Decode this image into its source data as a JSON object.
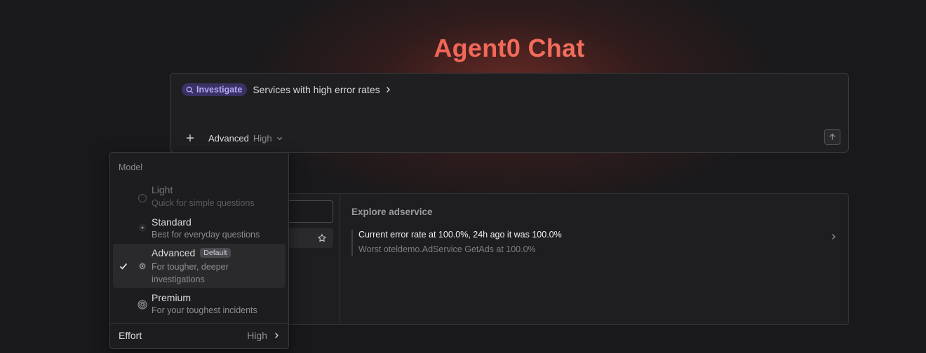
{
  "page": {
    "title": "Agent0 Chat",
    "accent_gradient": [
      "#ef4a44",
      "#f49a82"
    ]
  },
  "composer": {
    "suggestion_badge": "Investigate",
    "suggestion_badge_icon": "search-icon",
    "suggestion_text": "Services with high error rates",
    "add_icon": "plus-icon",
    "model_label": "Advanced",
    "effort_label": "High",
    "send_icon": "arrow-up-icon"
  },
  "panel": {
    "explore_title": "Explore adservice",
    "insight_main": "Current error rate at 100.0%, 24h ago it was 100.0%",
    "insight_sub": "Worst oteldemo.AdService GetAds at 100.0%"
  },
  "dropdown": {
    "header": "Model",
    "options": [
      {
        "label": "Light",
        "desc": "Quick for simple questions",
        "disabled": true,
        "selected": false
      },
      {
        "label": "Standard",
        "desc": "Best for everyday questions",
        "disabled": false,
        "selected": false
      },
      {
        "label": "Advanced",
        "badge": "Default",
        "desc": "For tougher, deeper investigations",
        "disabled": false,
        "selected": true
      },
      {
        "label": "Premium",
        "desc": "For your toughest incidents",
        "disabled": false,
        "selected": false
      }
    ],
    "effort_label": "Effort",
    "effort_value": "High"
  }
}
